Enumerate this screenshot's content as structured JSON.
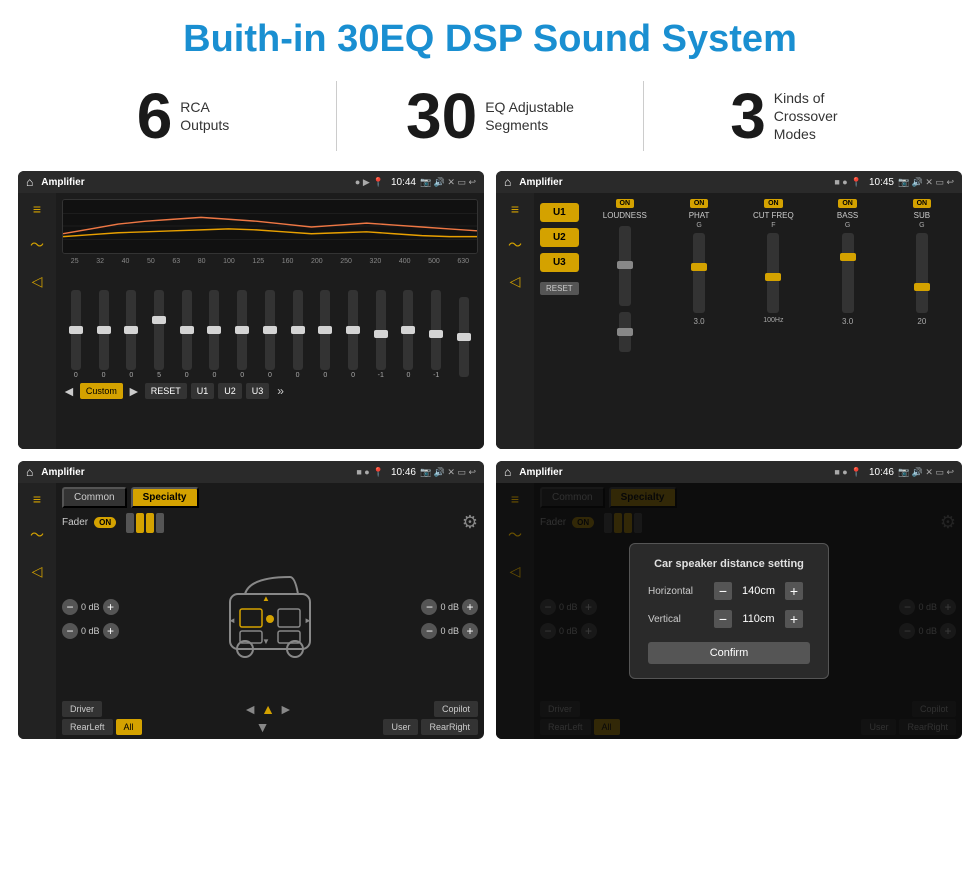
{
  "title": "Buith-in 30EQ DSP Sound System",
  "stats": [
    {
      "number": "6",
      "label": "RCA\nOutputs"
    },
    {
      "number": "30",
      "label": "EQ Adjustable\nSegments"
    },
    {
      "number": "3",
      "label": "Kinds of\nCrossover Modes"
    }
  ],
  "screen1": {
    "statusBar": {
      "home": "⌂",
      "title": "Amplifier",
      "time": "10:44"
    },
    "eqLabels": [
      "25",
      "32",
      "40",
      "50",
      "63",
      "80",
      "100",
      "125",
      "160",
      "200",
      "250",
      "320",
      "400",
      "500",
      "630"
    ],
    "sliderValues": [
      "0",
      "0",
      "0",
      "5",
      "0",
      "0",
      "0",
      "0",
      "0",
      "0",
      "0",
      "-1",
      "0",
      "-1"
    ],
    "buttons": [
      "Custom",
      "RESET",
      "U1",
      "U2",
      "U3"
    ]
  },
  "screen2": {
    "statusBar": {
      "home": "⌂",
      "title": "Amplifier",
      "time": "10:45"
    },
    "uButtons": [
      "U1",
      "U2",
      "U3"
    ],
    "controls": [
      {
        "label": "LOUDNESS",
        "on": true,
        "value": ""
      },
      {
        "label": "PHAT",
        "on": true,
        "value": "G"
      },
      {
        "label": "CUT FREQ",
        "on": true,
        "value": "F"
      },
      {
        "label": "BASS",
        "on": true,
        "value": "G"
      },
      {
        "label": "SUB",
        "on": true,
        "value": "G"
      }
    ],
    "resetBtn": "RESET"
  },
  "screen3": {
    "statusBar": {
      "home": "⌂",
      "title": "Amplifier",
      "time": "10:46"
    },
    "tabs": [
      "Common",
      "Specialty"
    ],
    "activeTab": "Specialty",
    "faderLabel": "Fader",
    "faderOn": "ON",
    "volumeRows": [
      {
        "left": "0 dB",
        "right": "0 dB"
      },
      {
        "left": "0 dB",
        "right": "0 dB"
      }
    ],
    "bottomBtns": [
      "Driver",
      "Copilot",
      "RearLeft",
      "All",
      "User",
      "RearRight"
    ]
  },
  "screen4": {
    "statusBar": {
      "home": "⌂",
      "title": "Amplifier",
      "time": "10:46"
    },
    "tabs": [
      "Common",
      "Specialty"
    ],
    "dialog": {
      "title": "Car speaker distance setting",
      "rows": [
        {
          "label": "Horizontal",
          "value": "140cm"
        },
        {
          "label": "Vertical",
          "value": "110cm"
        }
      ],
      "confirmBtn": "Confirm"
    },
    "bottomBtns": [
      "Driver",
      "Copilot",
      "RearLeft",
      "All",
      "User",
      "RearRight"
    ]
  },
  "colors": {
    "accent": "#d4a200",
    "blue": "#1a8fd1",
    "bg_dark": "#1c1c1c",
    "text_light": "#ffffff"
  }
}
